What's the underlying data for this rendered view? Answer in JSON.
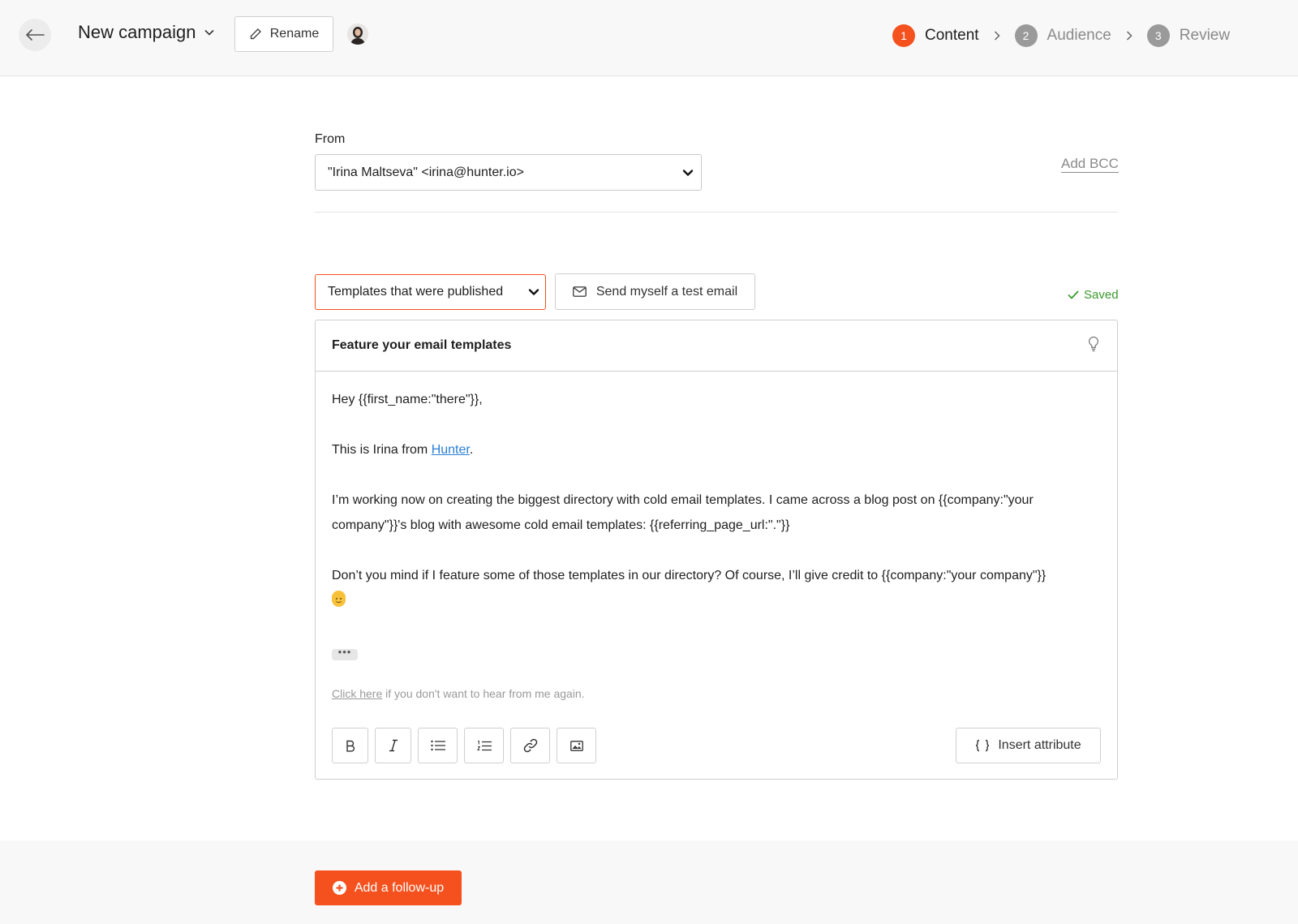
{
  "header": {
    "title": "New campaign",
    "rename_label": "Rename",
    "steps": [
      {
        "num": "1",
        "label": "Content",
        "state": "active"
      },
      {
        "num": "2",
        "label": "Audience",
        "state": "inactive"
      },
      {
        "num": "3",
        "label": "Review",
        "state": "inactive"
      }
    ]
  },
  "form": {
    "from_label": "From",
    "from_value": "\"Irina Maltseva\" <irina@hunter.io>",
    "add_bcc": "Add BCC",
    "template_select": "Templates that were published",
    "test_email_label": "Send myself a test email",
    "saved_label": "Saved"
  },
  "editor": {
    "subject": "Feature your email templates",
    "greeting": "Hey {{first_name:\"there\"}},",
    "intro_prefix": "This is Irina from ",
    "intro_link": "Hunter",
    "intro_suffix": ".",
    "para1": "I’m working now on creating the biggest directory with cold email templates. I came across a blog post on {{company:\"your company\"}}'s blog with awesome cold email templates: {{referring_page_url:\".\"}}",
    "para2": "Don’t you mind if I feature some of those templates in our directory? Of course, I’ll give credit to {{company:\"your company\"}}",
    "ellipsis": "•••",
    "unsub_link": "Click here",
    "unsub_text": " if you don't want to hear from me again.",
    "insert_attribute_label": "Insert attribute"
  },
  "footer": {
    "followup_label": "Add a follow-up"
  },
  "colors": {
    "accent": "#f4511e",
    "saved": "#3a9a2c",
    "link": "#2a7fd4"
  }
}
